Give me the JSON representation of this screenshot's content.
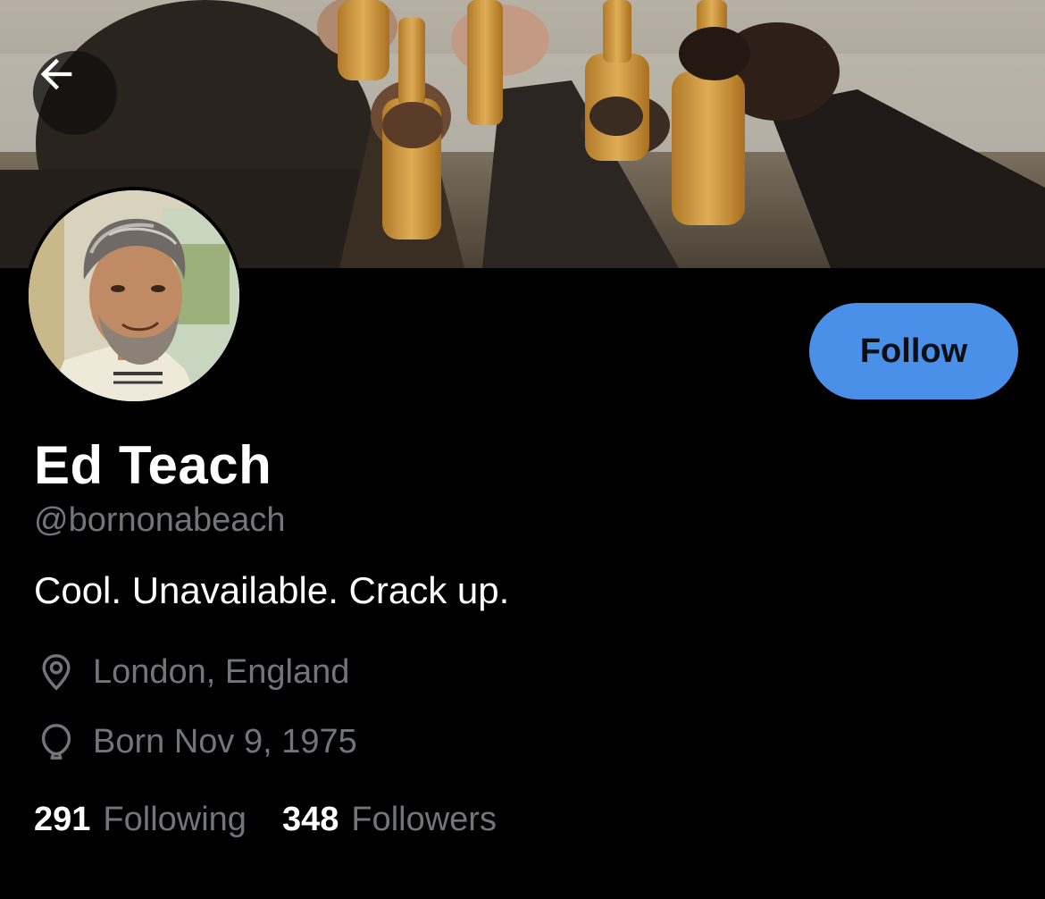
{
  "profile": {
    "display_name": "Ed Teach",
    "handle": "@bornonabeach",
    "bio": "Cool. Unavailable. Crack up.",
    "location": "London, England",
    "birth_date": "Born Nov 9, 1975",
    "following_count": "291",
    "following_label": "Following",
    "followers_count": "348",
    "followers_label": "Followers"
  },
  "actions": {
    "follow_label": "Follow"
  },
  "icons": {
    "back": "arrow-left-icon",
    "location": "location-pin-icon",
    "birth": "balloon-icon"
  },
  "colors": {
    "accent": "#4a90e8",
    "secondary_text": "#71767b",
    "background": "#000000"
  }
}
